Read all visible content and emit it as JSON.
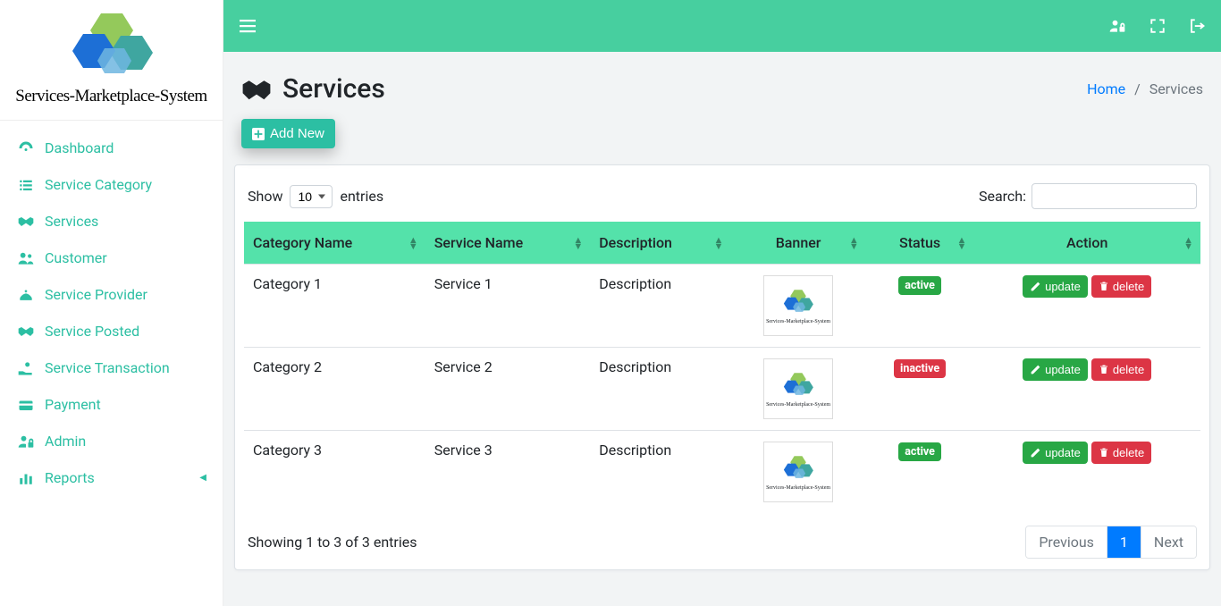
{
  "logo_text": "Services-Marketplace-System",
  "sidebar": {
    "items": [
      {
        "label": "Dashboard"
      },
      {
        "label": "Service Category"
      },
      {
        "label": "Services"
      },
      {
        "label": "Customer"
      },
      {
        "label": "Service Provider"
      },
      {
        "label": "Service Posted"
      },
      {
        "label": "Service Transaction"
      },
      {
        "label": "Payment"
      },
      {
        "label": "Admin"
      },
      {
        "label": "Reports"
      }
    ]
  },
  "page": {
    "title": "Services",
    "breadcrumb": {
      "home": "Home",
      "current": "Services"
    },
    "add_new": "Add New"
  },
  "datatable": {
    "show_label_pre": "Show",
    "show_label_post": "entries",
    "show_value": "10",
    "search_label": "Search:",
    "columns": {
      "c0": "Category Name",
      "c1": "Service Name",
      "c2": "Description",
      "c3": "Banner",
      "c4": "Status",
      "c5": "Action"
    },
    "rows": [
      {
        "category": "Category 1",
        "service": "Service 1",
        "description": "Description",
        "status": "active"
      },
      {
        "category": "Category 2",
        "service": "Service 2",
        "description": "Description",
        "status": "inactive"
      },
      {
        "category": "Category 3",
        "service": "Service 3",
        "description": "Description",
        "status": "active"
      }
    ],
    "info": "Showing 1 to 3 of 3 entries",
    "pagination": {
      "prev": "Previous",
      "page1": "1",
      "next": "Next"
    },
    "buttons": {
      "update": "update",
      "delete": "delete"
    }
  },
  "banner_text": "Services-Marketplace-System"
}
